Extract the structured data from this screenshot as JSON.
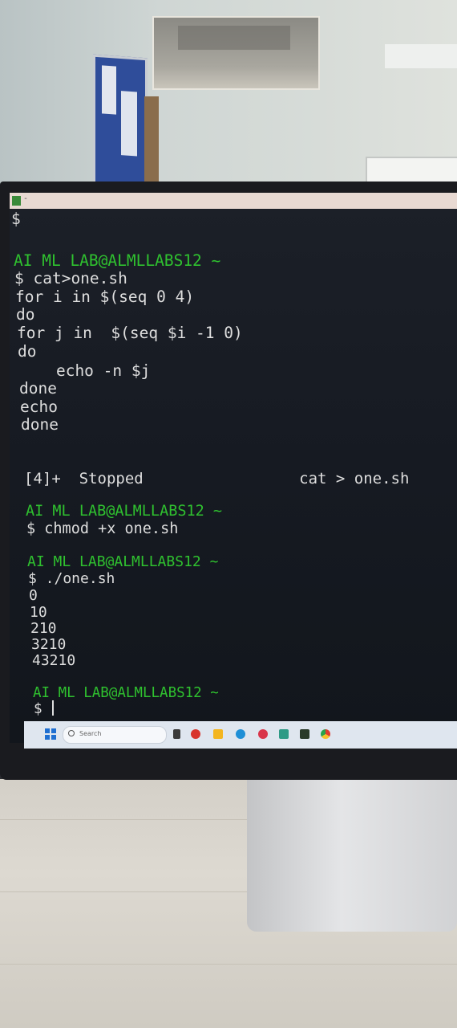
{
  "terminal": {
    "colors": {
      "prompt": "#2fc12f",
      "text": "#dedede",
      "background": "#161a22"
    },
    "lines": [
      {
        "text": "$",
        "kind": "text"
      },
      {
        "text": "",
        "kind": "text"
      },
      {
        "text": "AI ML LAB@ALMLLABS12 ~",
        "kind": "prompt"
      },
      {
        "text": "$ cat>one.sh",
        "kind": "text"
      },
      {
        "text": "for i in $(seq 0 4)",
        "kind": "text"
      },
      {
        "text": "do",
        "kind": "text"
      },
      {
        "text": "for j in  $(seq $i -1 0)",
        "kind": "text"
      },
      {
        "text": "do",
        "kind": "text"
      },
      {
        "text": "    echo -n $j",
        "kind": "text"
      },
      {
        "text": "done",
        "kind": "text"
      },
      {
        "text": "echo",
        "kind": "text"
      },
      {
        "text": "done",
        "kind": "text"
      },
      {
        "text": "[4]+  Stopped                 cat > one.sh",
        "kind": "text"
      },
      {
        "text": "AI ML LAB@ALMLLABS12 ~",
        "kind": "prompt"
      },
      {
        "text": "$ chmod +x one.sh",
        "kind": "text"
      },
      {
        "text": "AI ML LAB@ALMLLABS12 ~",
        "kind": "prompt"
      },
      {
        "text": "$ ./one.sh",
        "kind": "text"
      },
      {
        "text": "0",
        "kind": "text"
      },
      {
        "text": "10",
        "kind": "text"
      },
      {
        "text": "210",
        "kind": "text"
      },
      {
        "text": "3210",
        "kind": "text"
      },
      {
        "text": "43210",
        "kind": "text"
      },
      {
        "text": "AI ML LAB@ALMLLABS12 ~",
        "kind": "prompt"
      },
      {
        "text": "$ ",
        "kind": "input"
      }
    ]
  },
  "taskbar": {
    "search_placeholder": "Search",
    "icons": [
      "windows-start-icon",
      "search-icon",
      "task-view-icon",
      "chat-icon",
      "file-explorer-icon",
      "edge-icon",
      "wps-office-icon",
      "notepad-icon",
      "terminal-icon",
      "chrome-icon"
    ]
  }
}
